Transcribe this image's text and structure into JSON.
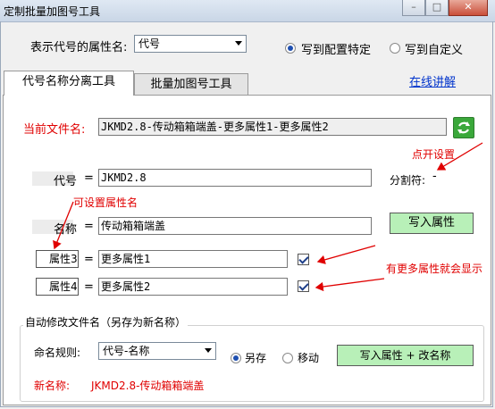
{
  "window": {
    "title": "定制批量加图号工具"
  },
  "top": {
    "code_attr_label": "表示代号的属性名:",
    "code_attr_value": "代号",
    "write_config_label": "写到配置特定",
    "write_custom_label": "写到自定义"
  },
  "tabs": {
    "tab1": "代号名称分离工具",
    "tab2": "批量加图号工具",
    "online_link": "在线讲解"
  },
  "file": {
    "label": "当前文件名:",
    "value": "JKMD2.8-传动箱箱端盖-更多属性1-更多属性2"
  },
  "fields": {
    "code_label": "代号",
    "code_eq": "=",
    "code_value": "JKMD2.8",
    "separator_label": "分割符:",
    "separator_value": "-",
    "name_label": "名称",
    "name_eq": "=",
    "name_value": "传动箱箱端盖",
    "write_attr_button": "写入属性",
    "attr3_label": "属性3",
    "attr3_eq": "=",
    "attr3_value": "更多属性1",
    "attr4_label": "属性4",
    "attr4_eq": "=",
    "attr4_value": "更多属性2"
  },
  "annotations": {
    "click_settings": "点开设置",
    "settable_attr": "可设置属性名",
    "more_attrs": "有更多属性就会显示"
  },
  "rename": {
    "group_title": "自动修改文件名（另存为新名称）",
    "rule_label": "命名规则:",
    "rule_value": "代号-名称",
    "save_as_label": "另存",
    "move_label": "移动",
    "write_rename_button": "写入属性 + 改名称",
    "new_name_label": "新名称:",
    "new_name_value": "JKMD2.8-传动箱箱端盖"
  },
  "colors": {
    "annotation": "#e00000",
    "button_green": "#b8f0b8",
    "link": "#0033cc"
  }
}
